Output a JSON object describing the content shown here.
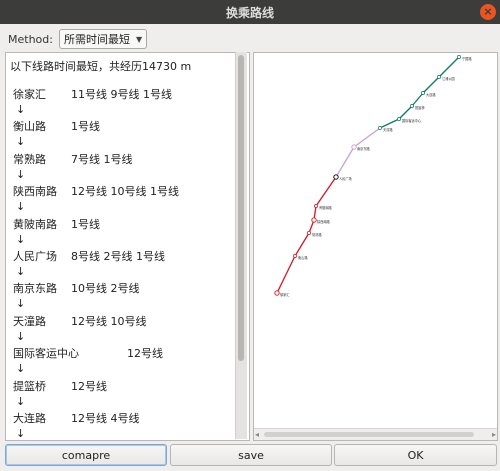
{
  "window": {
    "title": "换乘路线",
    "close_glyph": "×"
  },
  "method": {
    "label": "Method:",
    "selected": "所需时间最短"
  },
  "route": {
    "summary": "以下线路时间最短，共经历14730 m",
    "arrow": "↓",
    "stops": [
      {
        "name": "徐家汇",
        "lines": "11号线 9号线 1号线"
      },
      {
        "name": "衡山路",
        "lines": "1号线"
      },
      {
        "name": "常熟路",
        "lines": "7号线 1号线"
      },
      {
        "name": "陕西南路",
        "lines": "12号线 10号线 1号线"
      },
      {
        "name": "黄陂南路",
        "lines": "1号线"
      },
      {
        "name": "人民广场",
        "lines": "8号线 2号线 1号线"
      },
      {
        "name": "南京东路",
        "lines": "10号线 2号线"
      },
      {
        "name": "天潼路",
        "lines": "12号线 10号线"
      },
      {
        "name": "国际客运中心",
        "lines": "12号线"
      },
      {
        "name": "提篮桥",
        "lines": "12号线"
      },
      {
        "name": "大连路",
        "lines": "12号线 4号线"
      }
    ]
  },
  "map": {
    "colors": {
      "line1": "#d8141f",
      "line2": "#c8a0d8",
      "line12": "#0d7a63"
    },
    "labels": [
      "徐家汇",
      "衡山路",
      "常熟路",
      "陕西南路",
      "黄陂南路",
      "人民广场",
      "南京东路",
      "天潼路",
      "国际客运中心",
      "提篮桥",
      "大连路",
      "江浦公园",
      "宁国路",
      "隆昌路"
    ]
  },
  "buttons": {
    "compare": "comapre",
    "save": "save",
    "ok": "OK"
  }
}
